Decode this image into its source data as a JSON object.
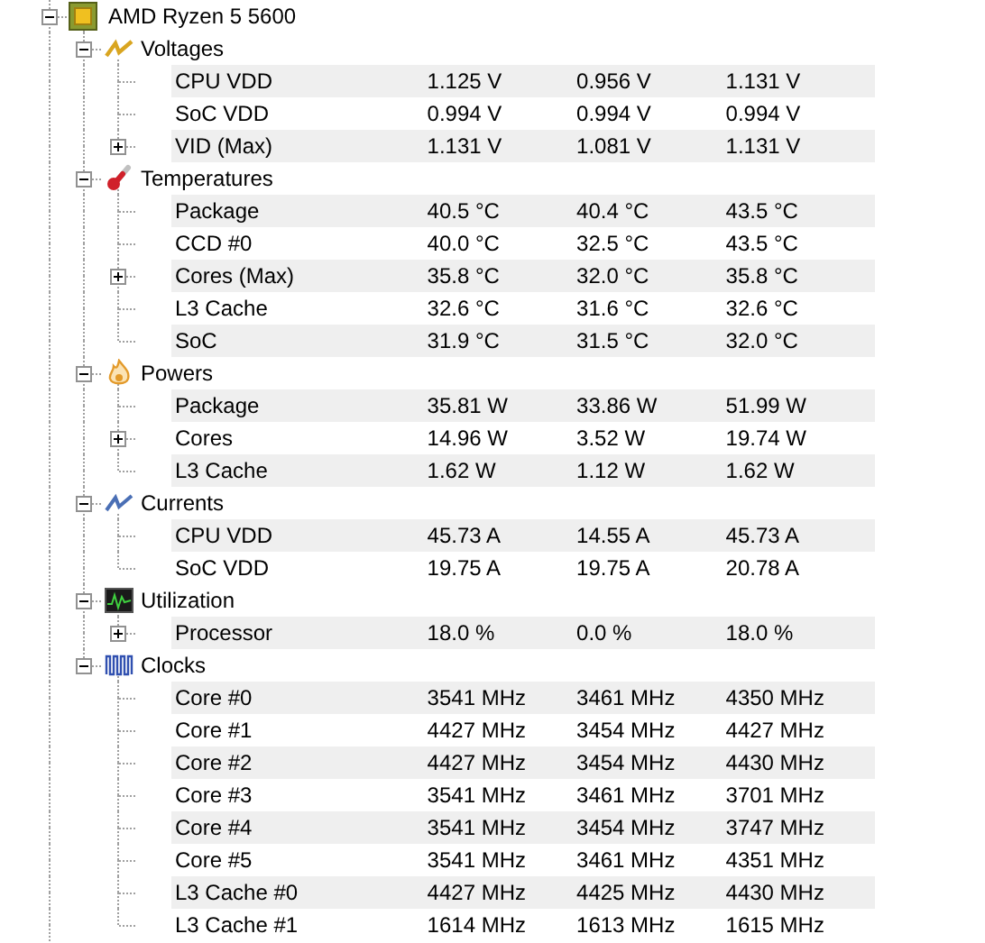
{
  "device": {
    "name": "AMD Ryzen 5 5600",
    "expanded": true,
    "groups": [
      {
        "kind": "voltage",
        "name": "Voltages",
        "expanded": true,
        "sensors": [
          {
            "kind": "leaf",
            "name": "CPU VDD",
            "values": [
              "1.125 V",
              "0.956 V",
              "1.131 V"
            ]
          },
          {
            "kind": "leaf",
            "name": "SoC VDD",
            "values": [
              "0.994 V",
              "0.994 V",
              "0.994 V"
            ]
          },
          {
            "kind": "collapsed",
            "name": "VID (Max)",
            "values": [
              "1.131 V",
              "1.081 V",
              "1.131 V"
            ]
          }
        ]
      },
      {
        "kind": "temperature",
        "name": "Temperatures",
        "expanded": true,
        "sensors": [
          {
            "kind": "leaf",
            "name": "Package",
            "values": [
              "40.5 °C",
              "40.4 °C",
              "43.5 °C"
            ]
          },
          {
            "kind": "leaf",
            "name": "CCD #0",
            "values": [
              "40.0 °C",
              "32.5 °C",
              "43.5 °C"
            ]
          },
          {
            "kind": "collapsed",
            "name": "Cores (Max)",
            "values": [
              "35.8 °C",
              "32.0 °C",
              "35.8 °C"
            ]
          },
          {
            "kind": "leaf",
            "name": "L3 Cache",
            "values": [
              "32.6 °C",
              "31.6 °C",
              "32.6 °C"
            ]
          },
          {
            "kind": "leaf",
            "name": "SoC",
            "values": [
              "31.9 °C",
              "31.5 °C",
              "32.0 °C"
            ]
          }
        ]
      },
      {
        "kind": "power",
        "name": "Powers",
        "expanded": true,
        "sensors": [
          {
            "kind": "leaf",
            "name": "Package",
            "values": [
              "35.81 W",
              "33.86 W",
              "51.99 W"
            ]
          },
          {
            "kind": "collapsed",
            "name": "Cores",
            "values": [
              "14.96 W",
              "3.52 W",
              "19.74 W"
            ]
          },
          {
            "kind": "leaf",
            "name": "L3 Cache",
            "values": [
              "1.62 W",
              "1.12 W",
              "1.62 W"
            ]
          }
        ]
      },
      {
        "kind": "current",
        "name": "Currents",
        "expanded": true,
        "sensors": [
          {
            "kind": "leaf",
            "name": "CPU VDD",
            "values": [
              "45.73 A",
              "14.55 A",
              "45.73 A"
            ]
          },
          {
            "kind": "leaf",
            "name": "SoC VDD",
            "values": [
              "19.75 A",
              "19.75 A",
              "20.78 A"
            ]
          }
        ]
      },
      {
        "kind": "utilization",
        "name": "Utilization",
        "expanded": true,
        "sensors": [
          {
            "kind": "collapsed",
            "name": "Processor",
            "values": [
              "18.0 %",
              "0.0 %",
              "18.0 %"
            ]
          }
        ]
      },
      {
        "kind": "clock",
        "name": "Clocks",
        "expanded": true,
        "sensors": [
          {
            "kind": "leaf",
            "name": "Core #0",
            "values": [
              "3541 MHz",
              "3461 MHz",
              "4350 MHz"
            ]
          },
          {
            "kind": "leaf",
            "name": "Core #1",
            "values": [
              "4427 MHz",
              "3454 MHz",
              "4427 MHz"
            ]
          },
          {
            "kind": "leaf",
            "name": "Core #2",
            "values": [
              "4427 MHz",
              "3454 MHz",
              "4430 MHz"
            ]
          },
          {
            "kind": "leaf",
            "name": "Core #3",
            "values": [
              "3541 MHz",
              "3461 MHz",
              "3701 MHz"
            ]
          },
          {
            "kind": "leaf",
            "name": "Core #4",
            "values": [
              "3541 MHz",
              "3454 MHz",
              "3747 MHz"
            ]
          },
          {
            "kind": "leaf",
            "name": "Core #5",
            "values": [
              "3541 MHz",
              "3461 MHz",
              "4351 MHz"
            ]
          },
          {
            "kind": "leaf",
            "name": "L3 Cache #0",
            "values": [
              "4427 MHz",
              "4425 MHz",
              "4430 MHz"
            ]
          },
          {
            "kind": "leaf",
            "name": "L3 Cache #1",
            "values": [
              "1614 MHz",
              "1613 MHz",
              "1615 MHz"
            ]
          }
        ]
      }
    ]
  }
}
